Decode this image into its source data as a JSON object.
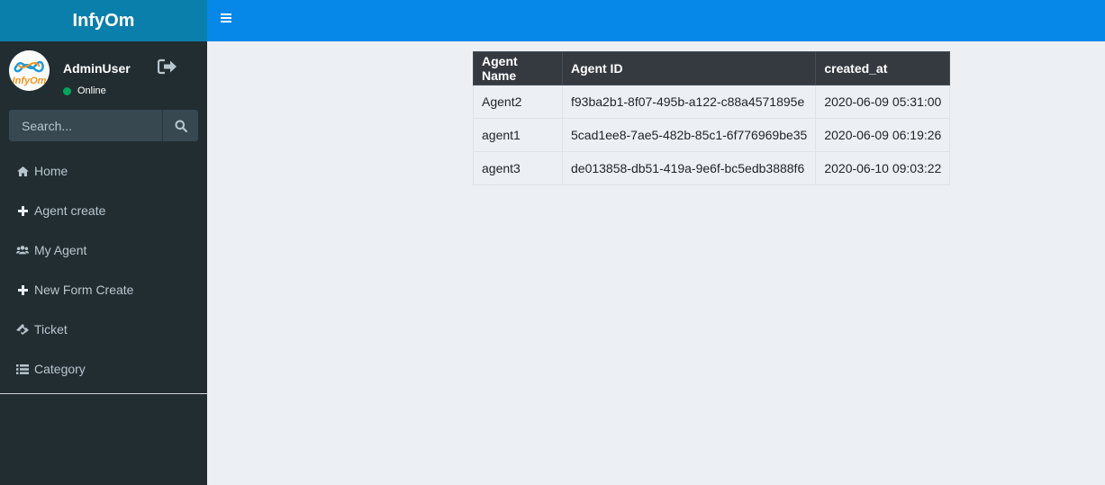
{
  "brand": {
    "name": "InfyOm",
    "logo_text": "InfyOm"
  },
  "header": {
    "toggle_icon": "bars-icon"
  },
  "user": {
    "name": "AdminUser",
    "status": "Online",
    "status_color": "#00a65a"
  },
  "search": {
    "placeholder": "Search..."
  },
  "sidebar": {
    "items": [
      {
        "label": "Home",
        "icon": "home-icon"
      },
      {
        "label": "Agent create",
        "icon": "plus-icon"
      },
      {
        "label": "My Agent",
        "icon": "users-icon"
      },
      {
        "label": "New Form Create",
        "icon": "plus-icon"
      },
      {
        "label": "Ticket",
        "icon": "ticket-icon"
      },
      {
        "label": "Category",
        "icon": "list-icon"
      }
    ]
  },
  "table": {
    "headers": [
      "Agent Name",
      "Agent ID",
      "created_at"
    ],
    "rows": [
      [
        "Agent2",
        "f93ba2b1-8f07-495b-a122-c88a4571895e",
        "2020-06-09 05:31:00"
      ],
      [
        "agent1",
        "5cad1ee8-7ae5-482b-85c1-6f776969be35",
        "2020-06-09 06:19:26"
      ],
      [
        "agent3",
        "de013858-db51-419a-9e6f-bc5edb3888f6",
        "2020-06-10 09:03:22"
      ]
    ]
  },
  "colors": {
    "logo_bar": "#0b7fab",
    "top_nav": "#0688e8",
    "sidebar": "#222d32",
    "table_header": "#343a40"
  }
}
